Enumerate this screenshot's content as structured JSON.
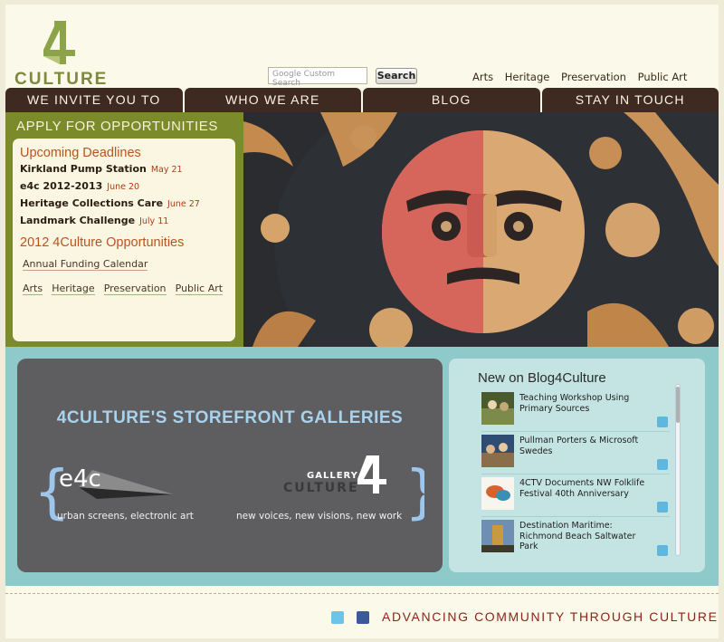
{
  "header": {
    "logo_text": "CULTURE",
    "search": {
      "placeholder": "Google Custom Search",
      "button": "Search"
    },
    "top_links": [
      "Arts",
      "Heritage",
      "Preservation",
      "Public Art"
    ]
  },
  "nav": [
    "WE INVITE YOU TO",
    "WHO WE ARE",
    "BLOG",
    "STAY IN TOUCH"
  ],
  "apply": {
    "title": "APPLY FOR OPPORTUNITIES",
    "upcoming_head": "Upcoming Deadlines",
    "deadlines": [
      {
        "name": "Kirkland Pump Station",
        "date": "May 21"
      },
      {
        "name": "e4c 2012-2013",
        "date": "June 20"
      },
      {
        "name": "Heritage Collections Care",
        "date": "June 27"
      },
      {
        "name": "Landmark Challenge",
        "date": "July 11"
      }
    ],
    "opps_head": "2012 4Culture Opportunities",
    "calendar_link": "Annual Funding Calendar",
    "category_links": [
      "Arts",
      "Heritage",
      "Preservation",
      "Public Art"
    ]
  },
  "galleries": {
    "title": "4CULTURE'S STOREFRONT GALLERIES",
    "e4c_logo": "e4c",
    "e4c_caption": "urban screens, electronic art",
    "gallery_label": "GALLERY",
    "gallery_word": "CULTURE",
    "gallery_caption": "new voices, new visions, new work"
  },
  "blog": {
    "title": "New on Blog4Culture",
    "items": [
      "Teaching Workshop Using Primary Sources",
      "Pullman Porters & Microsoft Swedes",
      "4CTV Documents NW Folklife Festival 40th Anniversary",
      "Destination Maritime: Richmond Beach Saltwater Park"
    ]
  },
  "footer": {
    "tagline": "ADVANCING COMMUNITY THROUGH CULTURE"
  },
  "colors": {
    "nav_bg": "#3f2a22",
    "green": "#7b8b2c",
    "teal": "#8fcaca",
    "accent_red": "#b03a18"
  }
}
